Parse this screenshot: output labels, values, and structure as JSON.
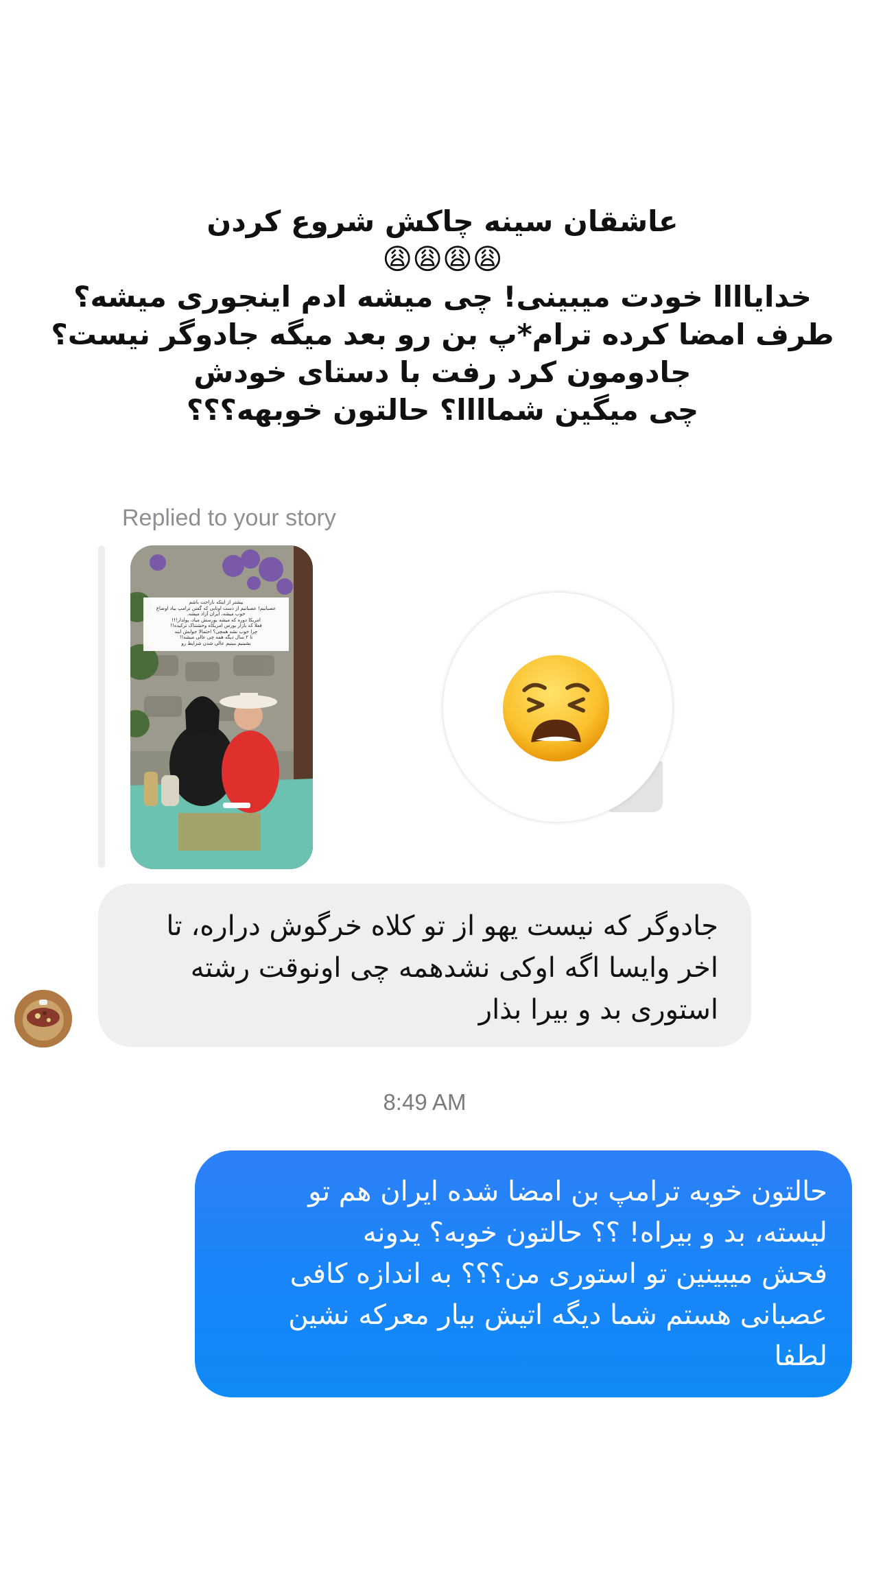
{
  "story_caption": {
    "lines": [
      "عاشقان سینه چاکش شروع کردن",
      "😩😩😩😩",
      "خدایاااا خودت میبینی! چی میشه ادم اینجوری میشه؟",
      "طرف امضا کرده ترام*پ  بن رو بعد میگه جادوگر نیست؟",
      "جادومون کرد رفت با دستای خودش",
      "چی میگین شماااا؟ حالتون خوبهه؟؟؟"
    ]
  },
  "reply": {
    "label": "Replied to your story",
    "story_thumbnail_text": [
      "بیشتر از اینکه ناراحت باشم",
      "عصبانیم! عصبانیم از دست اونایی که گفتن ترامپ بیاد اوضاع",
      "خوب میشه، ایران آزاد میشه.",
      "امریکا دوره که میشه بورسش میاد، پولدار!!!",
      "فعلا که بازار بورس امریکاه وحشتناک ترکیده!!",
      "چرا خوب نشد همچی؟ احتمالا جوابش اینه",
      "تا ۲ سال دیگه همه چی عالی میشه!!",
      "بشینیم ببینیم عالی شدن شرایط رو"
    ],
    "reaction_emoji": "😩"
  },
  "incoming_message": {
    "lines": [
      "جادوگر که نیست یهو از تو کلاه خرگوش دراره، تا",
      "اخر وایسا اگه اوکی نشدهمه چی اونوقت رشته",
      "استوری بد و بیرا بذار"
    ]
  },
  "timestamp": "8:49 AM",
  "outgoing_message": {
    "lines": [
      "حالتون خوبه ترامپ بن امضا شده ایران هم تو",
      "لیسته، بد و بیراه! ؟؟ حالتون خوبه؟ یدونه",
      "فحش میبینین تو استوری من؟؟؟ به اندازه کافی",
      "عصبانی هستم شما دیگه اتیش بیار معرکه نشین",
      "لطفا"
    ]
  },
  "colors": {
    "outgoing_bubble": "#1985f8",
    "incoming_bubble": "#efeff2",
    "secondary_text": "#8e8e93"
  }
}
